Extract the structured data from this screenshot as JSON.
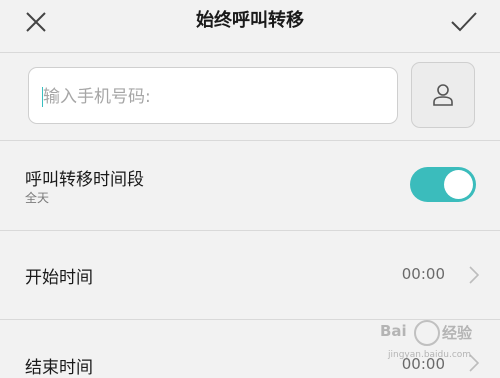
{
  "header": {
    "title": "始终呼叫转移"
  },
  "phone": {
    "placeholder": "输入手机号码:",
    "value": ""
  },
  "forward_period": {
    "label": "呼叫转移时间段",
    "subtitle": "全天",
    "enabled": true
  },
  "start_time": {
    "label": "开始时间",
    "value": "00:00"
  },
  "end_time": {
    "label": "结束时间",
    "value": "00:00"
  },
  "watermark": {
    "brand": "Bai",
    "brand2": "经验",
    "sub": "jingyan.baidu.com"
  },
  "colors": {
    "accent": "#3bbcbc",
    "background": "#f2f2f2"
  },
  "icons": {
    "close": "close-icon",
    "confirm": "check-icon",
    "contacts": "person-icon",
    "chevron": "chevron-right-icon"
  }
}
